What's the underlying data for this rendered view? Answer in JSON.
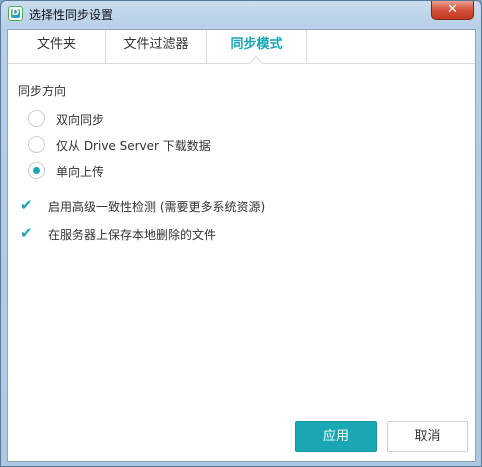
{
  "window": {
    "title": "选择性同步设置",
    "close_glyph": "✕"
  },
  "app_icon": {
    "name": "synology-drive-icon",
    "letter": "D"
  },
  "tabs": [
    {
      "label": "文件夹",
      "active": false
    },
    {
      "label": "文件过滤器",
      "active": false
    },
    {
      "label": "同步模式",
      "active": true
    }
  ],
  "sync_direction": {
    "label": "同步方向",
    "options": [
      {
        "label": "双向同步",
        "checked": false
      },
      {
        "label": "仅从 Drive Server 下载数据",
        "checked": false
      },
      {
        "label": "单向上传",
        "checked": true
      }
    ]
  },
  "checkboxes": [
    {
      "label": "启用高级一致性检测 (需要更多系统资源)",
      "checked": true
    },
    {
      "label": "在服务器上保存本地删除的文件",
      "checked": true
    }
  ],
  "buttons": {
    "apply": "应用",
    "cancel": "取消"
  },
  "colors": {
    "accent": "#1ba6b3",
    "titlebar": "#b7cfe7",
    "close": "#c43a22"
  }
}
